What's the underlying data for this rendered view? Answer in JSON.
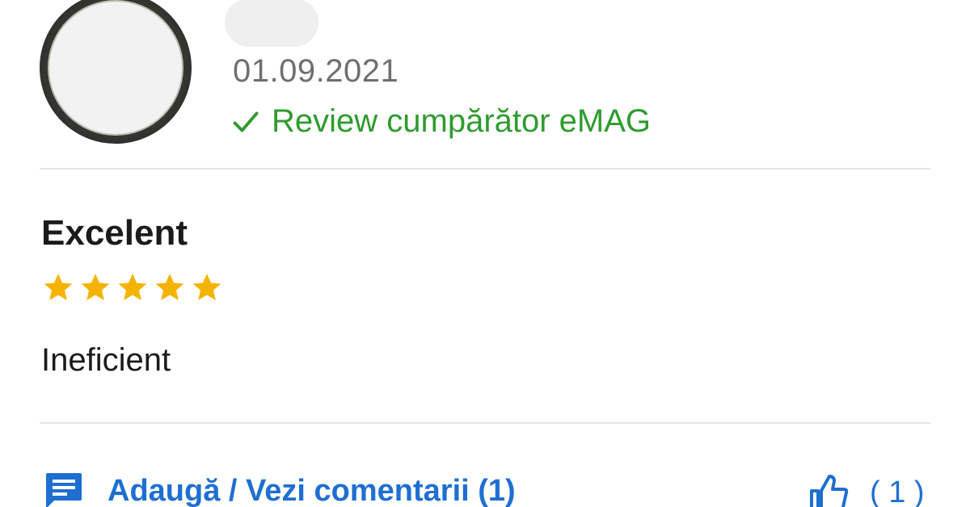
{
  "review": {
    "date": "01.09.2021",
    "verified_label": "Review cumpărător eMAG",
    "title": "Excelent",
    "rating": 5,
    "rating_max": 5,
    "text": "Ineficient"
  },
  "actions": {
    "comments_label": "Adaugă / Vezi comentarii (1)",
    "likes_label": "( 1 )"
  },
  "colors": {
    "verified": "#2e9b2e",
    "star": "#f5b301",
    "link": "#1f6fd1",
    "divider": "#e4e4e4"
  },
  "icons": {
    "verified": "check-icon",
    "rating": "star-icon",
    "comments": "comment-icon",
    "likes": "thumbs-up-icon"
  }
}
